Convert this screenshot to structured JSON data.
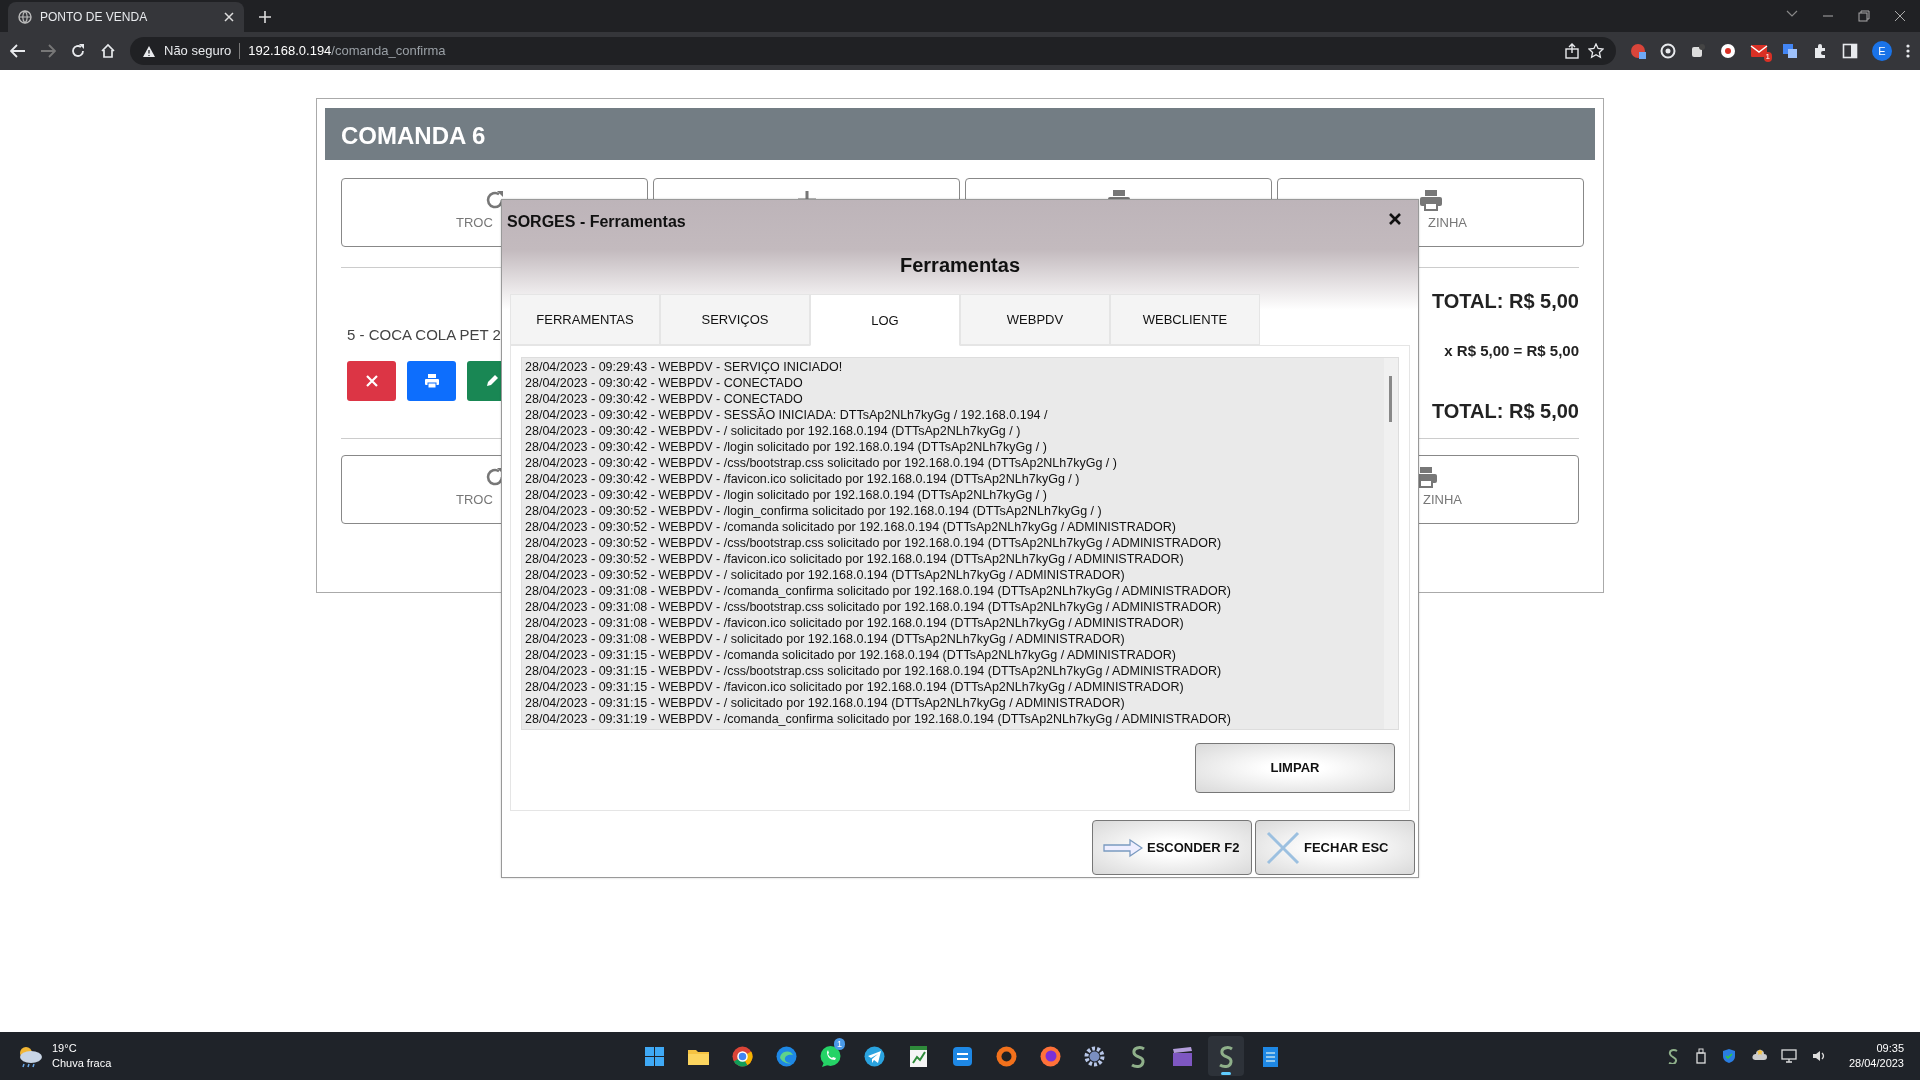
{
  "browser": {
    "tab_title": "PONTO DE VENDA",
    "security": "Não seguro",
    "url_host": "192.168.0.194",
    "url_path": "/comanda_confirma",
    "forward_disabled": true,
    "mail_badge": "1",
    "profile": "E"
  },
  "comanda": {
    "title": "COMANDA 6",
    "top_buttons": [
      {
        "kind": "refresh",
        "label": "TROC"
      },
      {
        "kind": "plus"
      },
      {
        "kind": "printer"
      },
      {
        "kind": "printer",
        "label": "ZINHA"
      }
    ],
    "total": "TOTAL: R$ 5,00",
    "item": {
      "name": "5 - COCA COLA PET 2",
      "price": "x R$ 5,00 = R$ 5,00"
    },
    "item_actions": [
      {
        "kind": "delete"
      },
      {
        "kind": "print"
      },
      {
        "kind": "edit"
      }
    ],
    "total_bottom": "TOTAL: R$ 5,00",
    "bottom_buttons": [
      {
        "kind": "refresh",
        "label": "TROC"
      },
      {
        "kind": "printer",
        "label": "ZINHA"
      }
    ]
  },
  "dialog": {
    "title": "SORGES - Ferramentas",
    "heading": "Ferramentas",
    "tabs": [
      {
        "label": "FERRAMENTAS",
        "selected": false
      },
      {
        "label": "SERVIÇOS",
        "selected": false
      },
      {
        "label": "LOG",
        "selected": true
      },
      {
        "label": "WEBPDV",
        "selected": false
      },
      {
        "label": "WEBCLIENTE",
        "selected": false
      }
    ],
    "log": [
      "28/04/2023 - 09:29:43 - WEBPDV - SERVIÇO INICIADO!",
      "28/04/2023 - 09:30:42 - WEBPDV - CONECTADO",
      "28/04/2023 - 09:30:42 - WEBPDV - CONECTADO",
      "28/04/2023 - 09:30:42 - WEBPDV - SESSÃO INICIADA: DTTsAp2NLh7kyGg / 192.168.0.194 /",
      "28/04/2023 - 09:30:42 - WEBPDV - / solicitado por 192.168.0.194 (DTTsAp2NLh7kyGg / )",
      "28/04/2023 - 09:30:42 - WEBPDV - /login solicitado por 192.168.0.194 (DTTsAp2NLh7kyGg / )",
      "28/04/2023 - 09:30:42 - WEBPDV - /css/bootstrap.css solicitado por 192.168.0.194 (DTTsAp2NLh7kyGg / )",
      "28/04/2023 - 09:30:42 - WEBPDV - /favicon.ico solicitado por 192.168.0.194 (DTTsAp2NLh7kyGg / )",
      "28/04/2023 - 09:30:42 - WEBPDV - /login solicitado por 192.168.0.194 (DTTsAp2NLh7kyGg / )",
      "28/04/2023 - 09:30:52 - WEBPDV - /login_confirma solicitado por 192.168.0.194 (DTTsAp2NLh7kyGg / )",
      "28/04/2023 - 09:30:52 - WEBPDV - /comanda solicitado por 192.168.0.194 (DTTsAp2NLh7kyGg / ADMINISTRADOR)",
      "28/04/2023 - 09:30:52 - WEBPDV - /css/bootstrap.css solicitado por 192.168.0.194 (DTTsAp2NLh7kyGg / ADMINISTRADOR)",
      "28/04/2023 - 09:30:52 - WEBPDV - /favicon.ico solicitado por 192.168.0.194 (DTTsAp2NLh7kyGg / ADMINISTRADOR)",
      "28/04/2023 - 09:30:52 - WEBPDV - / solicitado por 192.168.0.194 (DTTsAp2NLh7kyGg / ADMINISTRADOR)",
      "28/04/2023 - 09:31:08 - WEBPDV - /comanda_confirma solicitado por 192.168.0.194 (DTTsAp2NLh7kyGg / ADMINISTRADOR)",
      "28/04/2023 - 09:31:08 - WEBPDV - /css/bootstrap.css solicitado por 192.168.0.194 (DTTsAp2NLh7kyGg / ADMINISTRADOR)",
      "28/04/2023 - 09:31:08 - WEBPDV - /favicon.ico solicitado por 192.168.0.194 (DTTsAp2NLh7kyGg / ADMINISTRADOR)",
      "28/04/2023 - 09:31:08 - WEBPDV - / solicitado por 192.168.0.194 (DTTsAp2NLh7kyGg / ADMINISTRADOR)",
      "28/04/2023 - 09:31:15 - WEBPDV - /comanda solicitado por 192.168.0.194 (DTTsAp2NLh7kyGg / ADMINISTRADOR)",
      "28/04/2023 - 09:31:15 - WEBPDV - /css/bootstrap.css solicitado por 192.168.0.194 (DTTsAp2NLh7kyGg / ADMINISTRADOR)",
      "28/04/2023 - 09:31:15 - WEBPDV - /favicon.ico solicitado por 192.168.0.194 (DTTsAp2NLh7kyGg / ADMINISTRADOR)",
      "28/04/2023 - 09:31:15 - WEBPDV - / solicitado por 192.168.0.194 (DTTsAp2NLh7kyGg / ADMINISTRADOR)",
      "28/04/2023 - 09:31:19 - WEBPDV - /comanda_confirma solicitado por 192.168.0.194 (DTTsAp2NLh7kyGg / ADMINISTRADOR)"
    ],
    "clear_button": "LIMPAR",
    "footer_buttons": [
      {
        "kind": "hide",
        "label": "ESCONDER F2"
      },
      {
        "kind": "close",
        "label": "FECHAR ESC"
      }
    ]
  },
  "taskbar": {
    "temperature": "19°C",
    "weather": "Chuva fraca",
    "apps": [
      {
        "kind": "start",
        "active": false
      },
      {
        "kind": "folder",
        "active": false
      },
      {
        "kind": "chrome",
        "active": false
      },
      {
        "kind": "edge",
        "active": false
      },
      {
        "kind": "chat",
        "active": false,
        "badge": "1"
      },
      {
        "kind": "plane",
        "active": false
      },
      {
        "kind": "sheet",
        "active": false
      },
      {
        "kind": "bluebox",
        "active": false
      },
      {
        "kind": "orange",
        "active": false
      },
      {
        "kind": "firefox",
        "active": false
      },
      {
        "kind": "gear",
        "active": false
      },
      {
        "kind": "sapp",
        "active": false
      },
      {
        "kind": "clapper",
        "active": false
      },
      {
        "kind": "sapp",
        "active": true
      },
      {
        "kind": "notepad",
        "active": false
      }
    ],
    "time": "09:35",
    "date": "28/04/2023"
  }
}
